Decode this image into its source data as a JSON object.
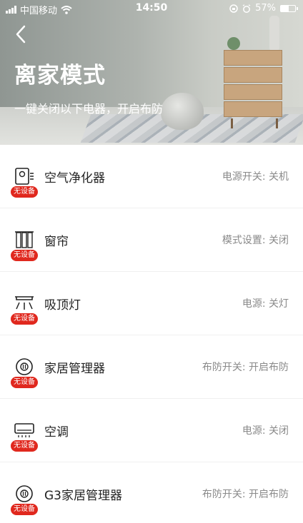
{
  "status_bar": {
    "carrier": "中国移动",
    "time": "14:50",
    "battery": "57%",
    "battery_level": 0.57
  },
  "header": {
    "title": "离家模式",
    "subtitle": "一键关闭以下电器，开启布防"
  },
  "devices": [
    {
      "name": "空气净化器",
      "badge": "无设备",
      "status": "电源开关: 关机",
      "icon": "air-purifier-icon"
    },
    {
      "name": "窗帘",
      "badge": "无设备",
      "status": "模式设置: 关闭",
      "icon": "curtain-icon"
    },
    {
      "name": "吸顶灯",
      "badge": "无设备",
      "status": "电源: 关灯",
      "icon": "ceiling-light-icon"
    },
    {
      "name": "家居管理器",
      "badge": "无设备",
      "status": "布防开关: 开启布防",
      "icon": "home-manager-icon"
    },
    {
      "name": "空调",
      "badge": "无设备",
      "status": "电源: 关闭",
      "icon": "air-conditioner-icon"
    },
    {
      "name": "G3家居管理器",
      "badge": "无设备",
      "status": "布防开关: 开启布防",
      "icon": "home-manager-icon"
    }
  ],
  "colors": {
    "badge": "#e0281e",
    "status_text": "#8a8a8a"
  }
}
